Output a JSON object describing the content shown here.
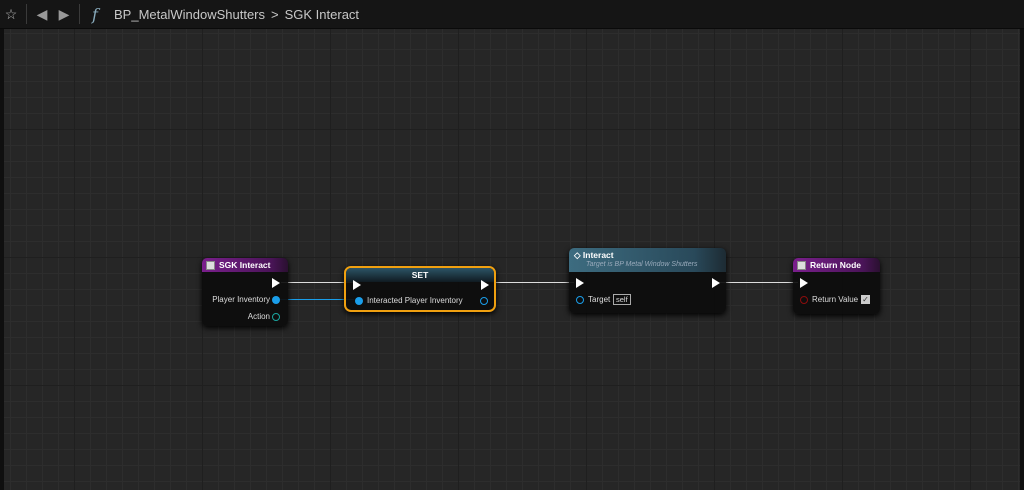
{
  "toolbar": {
    "breadcrumb_root": "BP_MetalWindowShutters",
    "breadcrumb_sep": ">",
    "breadcrumb_current": "SGK Interact",
    "icons": [
      "star-icon",
      "back-arrow-icon",
      "forward-arrow-icon",
      "function-icon"
    ]
  },
  "nodes": {
    "entry": {
      "title": "SGK Interact",
      "pins": [
        "Player Inventory",
        "Action"
      ]
    },
    "set": {
      "title": "SET",
      "pin": "Interacted Player Inventory"
    },
    "interact": {
      "title": "Interact",
      "subtitle": "Target is BP Metal Window Shutters",
      "pin": "Target",
      "default": "self"
    },
    "return": {
      "title": "Return Node",
      "pin": "Return Value",
      "checked": true
    }
  },
  "colors": {
    "exec": "#ffffff",
    "object_pin": "#1a9eea",
    "bool_pin": "#8c0d0d",
    "selection": "#f0a010",
    "entry_header": "#7a1f8c",
    "call_header": "#3d6c80"
  }
}
